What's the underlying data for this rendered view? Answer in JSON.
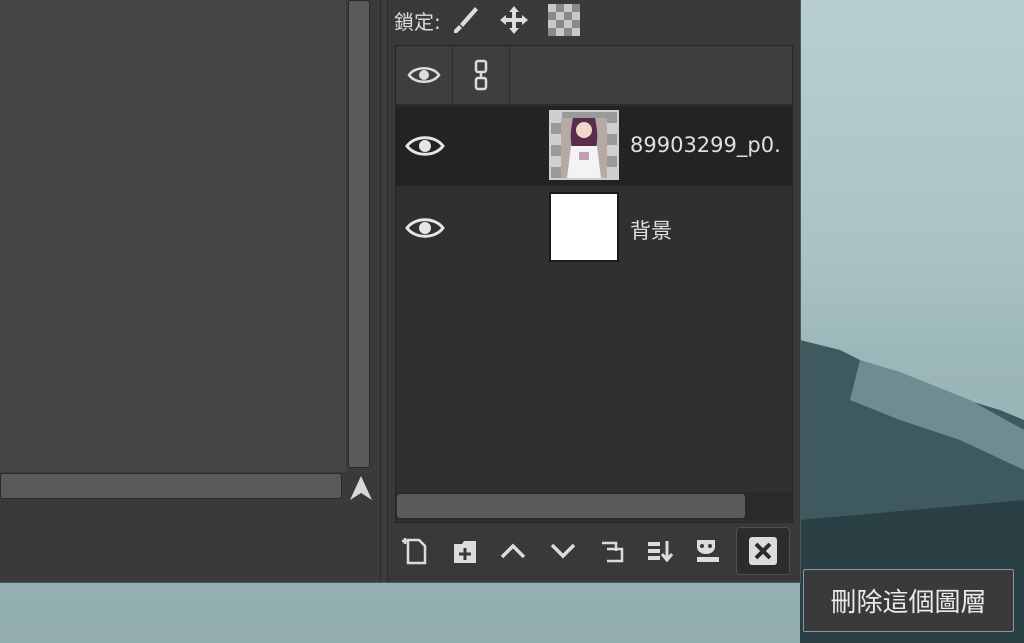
{
  "lock": {
    "label": "鎖定:",
    "icons": [
      "brush-lock-icon",
      "move-lock-icon",
      "alpha-lock-icon"
    ]
  },
  "layers_panel": {
    "header_icons": [
      "eye-icon",
      "chain-link-icon"
    ],
    "layers": [
      {
        "name": "89903299_p0.",
        "visible": true,
        "selected": true,
        "thumbnail": "anime-artwork-thumbnail"
      },
      {
        "name": "背景",
        "visible": true,
        "selected": false,
        "thumbnail": "white-fill-thumbnail"
      }
    ]
  },
  "toolbar": {
    "buttons": [
      "new-layer-icon",
      "new-layer-group-icon",
      "raise-layer-icon",
      "lower-layer-icon",
      "duplicate-layer-icon",
      "merge-down-icon",
      "layer-mask-icon",
      "delete-layer-icon"
    ]
  },
  "tooltip": {
    "text": "刪除這個圖層"
  },
  "colors": {
    "window_bg": "#3a3a3a",
    "panel_bg": "#303030",
    "selected_row": "#232323",
    "text": "#e0e0e0"
  }
}
